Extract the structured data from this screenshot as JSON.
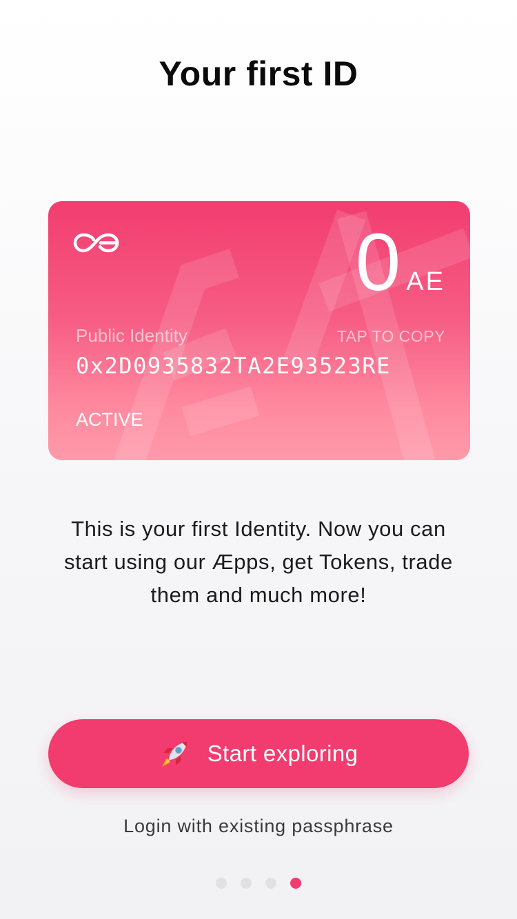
{
  "page": {
    "title": "Your first ID"
  },
  "card": {
    "logo_icon": "aeternity-logo-icon",
    "balance_value": "0",
    "balance_unit": "AE",
    "public_identity_label": "Public Identity",
    "tap_to_copy_label": "TAP TO COPY",
    "address": "0x2D0935832TA2E93523RE",
    "status": "ACTIVE",
    "colors": {
      "top": "#f23d70",
      "bottom": "#ff9aab"
    }
  },
  "description": {
    "line1": "This is your first Identity. Now you can",
    "line2": "start using our Æpps, get Tokens, trade",
    "line3": "them and much more!"
  },
  "actions": {
    "start_icon": "rocket-icon",
    "start_label": "Start exploring",
    "login_label": "Login with existing passphrase"
  },
  "pagination": {
    "total": 4,
    "active_index": 3
  },
  "colors": {
    "accent": "#f23b6f",
    "dot_inactive": "#e1e1e4"
  }
}
